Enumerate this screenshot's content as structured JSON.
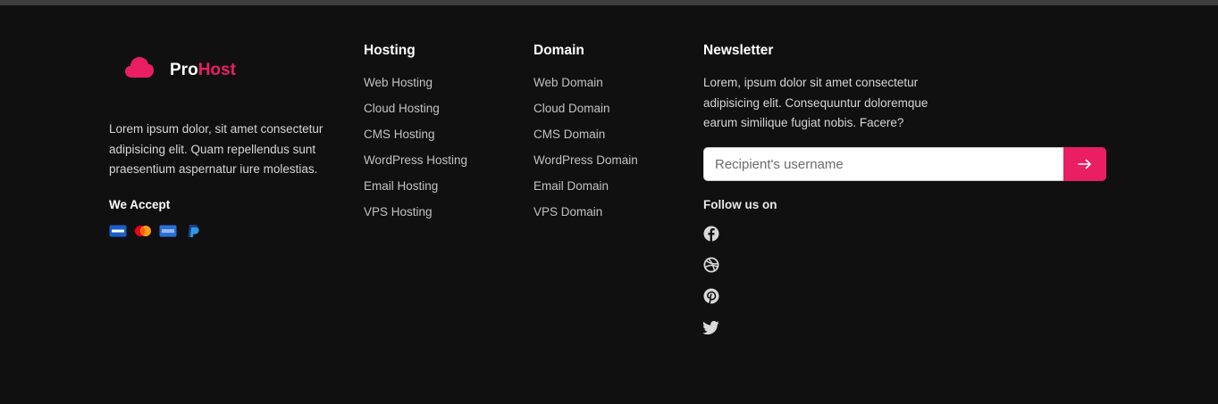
{
  "brand": {
    "name_part1": "Pro",
    "name_part2": "Host",
    "description": "Lorem ipsum dolor, sit amet consectetur adipisicing elit. Quam repellendus sunt praesentium aspernatur iure molestias.",
    "accept_title": "We Accept",
    "payment_icons": [
      "visa-icon",
      "mastercard-icon",
      "amex-icon",
      "paypal-icon"
    ],
    "accent_color": "#e91e63"
  },
  "hosting": {
    "title": "Hosting",
    "links": [
      "Web Hosting",
      "Cloud Hosting",
      "CMS Hosting",
      "WordPress Hosting",
      "Email Hosting",
      "VPS Hosting"
    ]
  },
  "domain": {
    "title": "Domain",
    "links": [
      "Web Domain",
      "Cloud Domain",
      "CMS Domain",
      "WordPress Domain",
      "Email Domain",
      "VPS Domain"
    ]
  },
  "newsletter": {
    "title": "Newsletter",
    "description": "Lorem, ipsum dolor sit amet consectetur adipisicing elit. Consequuntur doloremque earum similique fugiat nobis. Facere?",
    "input_placeholder": "Recipient's username",
    "input_value": "",
    "submit_icon": "arrow-right-icon",
    "follow_title": "Follow us on",
    "social_icons": [
      "facebook-icon",
      "dribbble-icon",
      "pinterest-icon",
      "twitter-icon"
    ]
  },
  "colors": {
    "background": "#111011",
    "accent": "#e91e63",
    "link": "#c2c2c2"
  }
}
